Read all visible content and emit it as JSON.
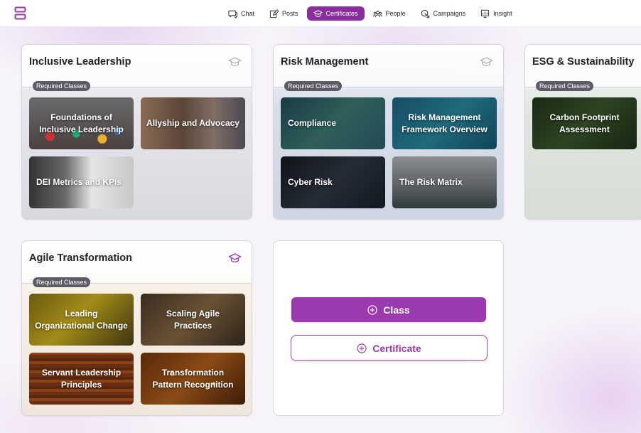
{
  "nav": {
    "items": [
      {
        "label": "Chat",
        "icon": "chat-icon",
        "active": false
      },
      {
        "label": "Posts",
        "icon": "edit-icon",
        "active": false
      },
      {
        "label": "Certificates",
        "icon": "graduation-cap-icon",
        "active": true
      },
      {
        "label": "People",
        "icon": "people-icon",
        "active": false
      },
      {
        "label": "Campaigns",
        "icon": "campaign-icon",
        "active": false
      },
      {
        "label": "Insight",
        "icon": "insight-icon",
        "active": false
      }
    ]
  },
  "cards": [
    {
      "title": "Inclusive Leadership",
      "required_label": "Required Classes",
      "classes": [
        "Foundations of Inclusive Leadership",
        "Allyship and Advocacy",
        "DEI Metrics and KPIs"
      ]
    },
    {
      "title": "Risk Management",
      "required_label": "Required Classes",
      "classes": [
        "Compliance",
        "Risk Management Framework Overview",
        "Cyber Risk",
        "The Risk Matrix"
      ]
    },
    {
      "title": "ESG & Sustainability",
      "required_label": "Required Classes",
      "classes": [
        "Carbon Footprint Assessment"
      ]
    },
    {
      "title": "Agile Transformation",
      "required_label": "Required Classes",
      "classes": [
        "Leading Organizational Change",
        "Scaling Agile Practices",
        "Servant Leadership Principles",
        "Transformation Pattern Recognition"
      ]
    }
  ],
  "actions": {
    "class_label": "Class",
    "certificate_label": "Certificate"
  },
  "colors": {
    "accent": "#9b3aae",
    "nav_active": "#8a2d9c",
    "pill": "#5c5c66"
  }
}
